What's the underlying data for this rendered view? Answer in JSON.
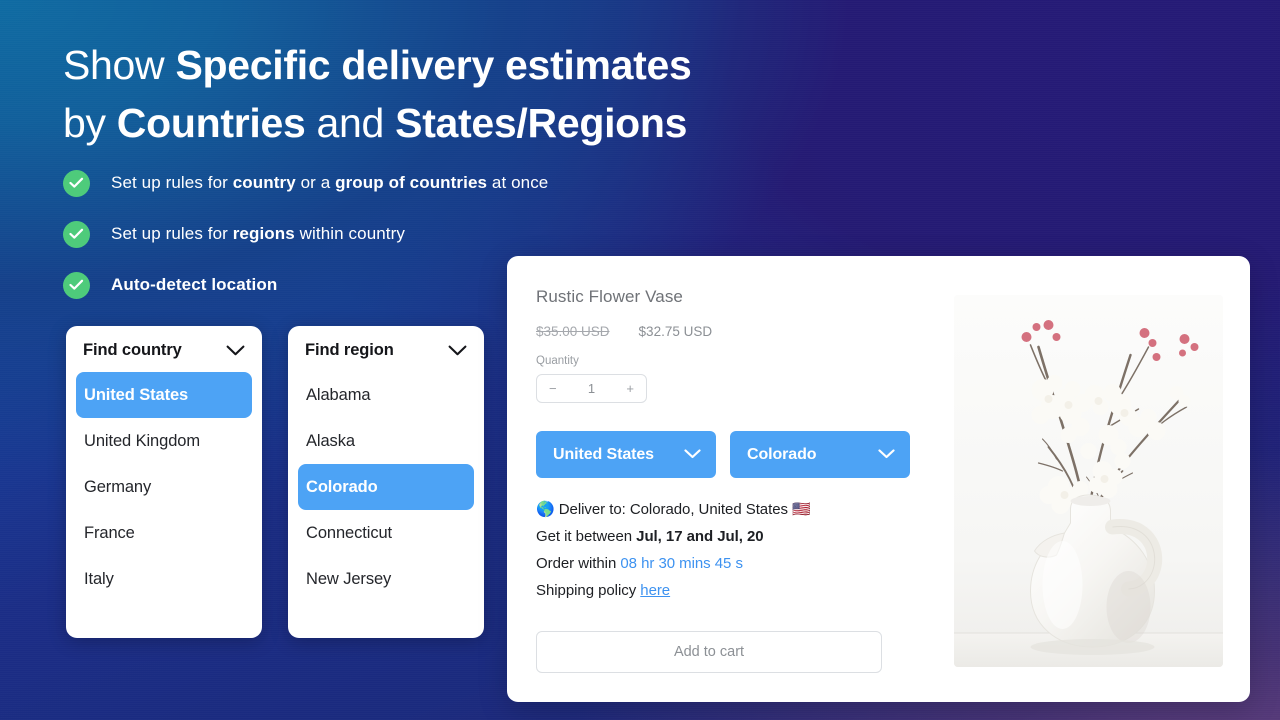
{
  "background": {
    "colors": [
      "#0f6ca3",
      "#17409b",
      "#1b2d86",
      "#241a73",
      "#6e4882"
    ]
  },
  "headline": {
    "line1_plain": "Show ",
    "line1_bold": "Specific delivery estimates",
    "line2_plain1": "by ",
    "line2_bold1": "Countries",
    "line2_plain2": " and ",
    "line2_bold2": "States/Regions"
  },
  "features": [
    {
      "icon": "check-circle-icon",
      "parts": [
        {
          "text": "Set up rules for ",
          "bold": false
        },
        {
          "text": "country",
          "bold": true
        },
        {
          "text": " or a ",
          "bold": false
        },
        {
          "text": "group of countries",
          "bold": true
        },
        {
          "text": " at once",
          "bold": false
        }
      ]
    },
    {
      "icon": "check-circle-icon",
      "parts": [
        {
          "text": "Set up rules for ",
          "bold": false
        },
        {
          "text": "regions",
          "bold": true
        },
        {
          "text": " within country",
          "bold": false
        }
      ]
    },
    {
      "icon": "check-circle-icon",
      "parts": [
        {
          "text": "Auto-detect location",
          "bold": true
        }
      ]
    }
  ],
  "country_dropdown": {
    "label": "Find country",
    "chevron": "chevron-down-icon",
    "options": [
      {
        "label": "United States",
        "selected": true
      },
      {
        "label": "United Kingdom",
        "selected": false
      },
      {
        "label": "Germany",
        "selected": false
      },
      {
        "label": "France",
        "selected": false
      },
      {
        "label": "Italy",
        "selected": false
      }
    ]
  },
  "region_dropdown": {
    "label": "Find region",
    "chevron": "chevron-down-icon",
    "options": [
      {
        "label": "Alabama",
        "selected": false
      },
      {
        "label": "Alaska",
        "selected": false
      },
      {
        "label": "Colorado",
        "selected": true
      },
      {
        "label": "Connecticut",
        "selected": false
      },
      {
        "label": "New Jersey",
        "selected": false
      }
    ]
  },
  "product_card": {
    "title": "Rustic Flower Vase",
    "price_original": "$35.00 USD",
    "price_current": "$32.75 USD",
    "quantity_label": "Quantity",
    "quantity_decrement": "−",
    "quantity_value": "1",
    "quantity_increment": "+",
    "selected_country": "United States",
    "selected_region": "Colorado",
    "accent_color": "#4DA3F5",
    "deliver_to": {
      "globe_emoji": "🌎",
      "text": "Deliver to: Colorado, United States",
      "flag_emoji": "🇺🇸"
    },
    "get_it_between": {
      "prefix": "Get it between ",
      "dates": "Jul, 17 and Jul, 20"
    },
    "order_within": {
      "prefix": "Order within ",
      "countdown": "08 hr 30 mins 45 s"
    },
    "shipping_policy": {
      "prefix": "Shipping policy ",
      "link_text": "here"
    },
    "add_to_cart_label": "Add to cart",
    "image_alt": "white ceramic jug vase with blossom branches"
  }
}
